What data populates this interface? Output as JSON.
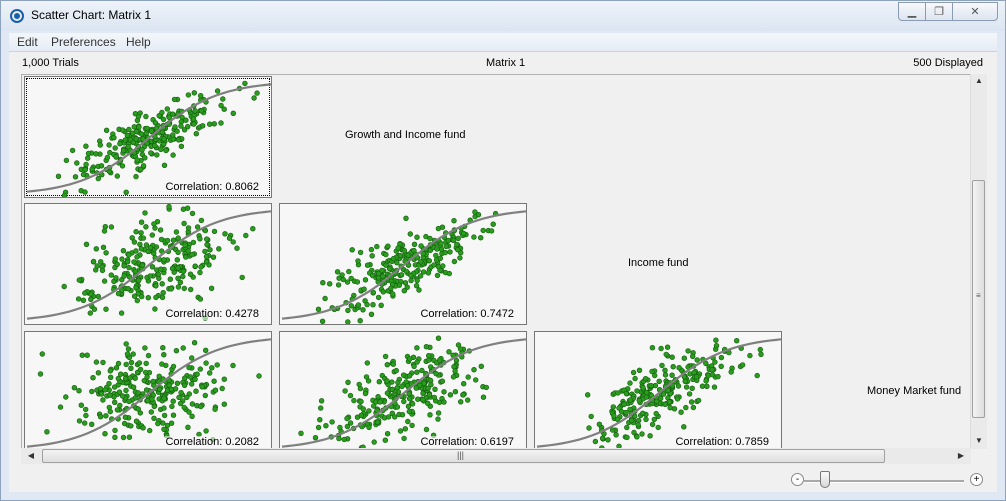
{
  "window": {
    "title": "Scatter Chart: Matrix 1",
    "controls": {
      "minimize_icon": "minimize-icon",
      "maximize_icon": "restore-icon",
      "close_icon": "close-icon"
    }
  },
  "menu": {
    "items": [
      "Edit",
      "Preferences",
      "Help"
    ]
  },
  "header": {
    "trials": "1,000 Trials",
    "matrix": "Matrix 1",
    "displayed": "500 Displayed"
  },
  "labels": {
    "growth": "Growth and Income fund",
    "income": "Income fund",
    "money": "Money Market fund"
  },
  "correlations": {
    "c11": "Correlation: 0.8062",
    "c21": "Correlation: 0.4278",
    "c22": "Correlation: 0.7472",
    "c31": "Correlation: 0.2082",
    "c32": "Correlation: 0.6197",
    "c33": "Correlation: 0.7859"
  },
  "chart_data": {
    "type": "scatter",
    "points_displayed": 500,
    "point_color": "#2a9d1f",
    "trend_color": "#808080",
    "cells": [
      {
        "row": 1,
        "col": 1,
        "correlation": 0.8062
      },
      {
        "row": 2,
        "col": 1,
        "correlation": 0.4278
      },
      {
        "row": 2,
        "col": 2,
        "correlation": 0.7472
      },
      {
        "row": 3,
        "col": 1,
        "correlation": 0.2082
      },
      {
        "row": 3,
        "col": 2,
        "correlation": 0.6197
      },
      {
        "row": 3,
        "col": 3,
        "correlation": 0.7859
      }
    ]
  },
  "scrollbars": {
    "vertical_grip": "≡",
    "horizontal_grip": "|||",
    "up": "▲",
    "down": "▼",
    "left": "◀",
    "right": "▶"
  },
  "zoom": {
    "minus": "-",
    "plus": "+",
    "level": 0.1
  }
}
